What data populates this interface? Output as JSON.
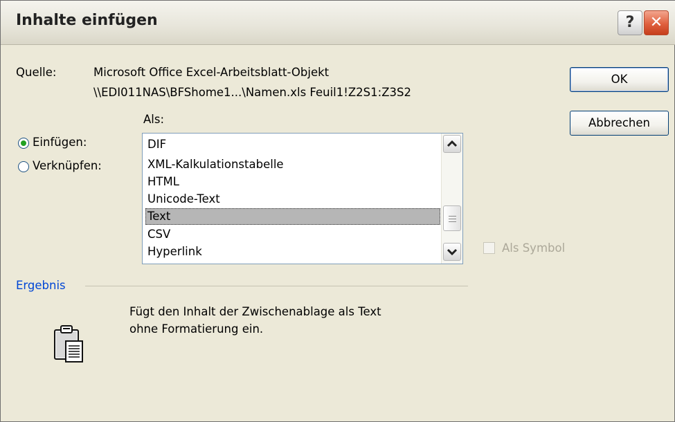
{
  "window": {
    "title": "Inhalte einfügen",
    "help_label": "?",
    "close_label": "✕"
  },
  "source": {
    "label": "Quelle:",
    "line1": "Microsoft Office Excel-Arbeitsblatt-Objekt",
    "line2": "\\\\EDI011NAS\\BFShome1...\\Namen.xls Feuil1!Z2S1:Z3S2"
  },
  "as_label": "Als:",
  "mode": {
    "paste": {
      "label": "Einfügen:",
      "selected": true
    },
    "link": {
      "label": "Verknüpfen:",
      "selected": false
    }
  },
  "formats": {
    "items": [
      "DIF",
      "XML-Kalkulationstabelle",
      "HTML",
      "Unicode-Text",
      "Text",
      "CSV",
      "Hyperlink"
    ],
    "selected": "Text"
  },
  "buttons": {
    "ok": "OK",
    "cancel": "Abbrechen"
  },
  "as_icon": {
    "label": "Als Symbol",
    "checked": false,
    "enabled": false
  },
  "result": {
    "heading": "Ergebnis",
    "line1": "Fügt den Inhalt der Zwischenablage als Text",
    "line2": "ohne Formatierung ein.",
    "icon": "clipboard-icon"
  },
  "colors": {
    "dialog_bg": "#ece9d8",
    "heading_blue": "#0046d5",
    "selection": "#b6b6b6",
    "radio_dot": "#21a121"
  }
}
